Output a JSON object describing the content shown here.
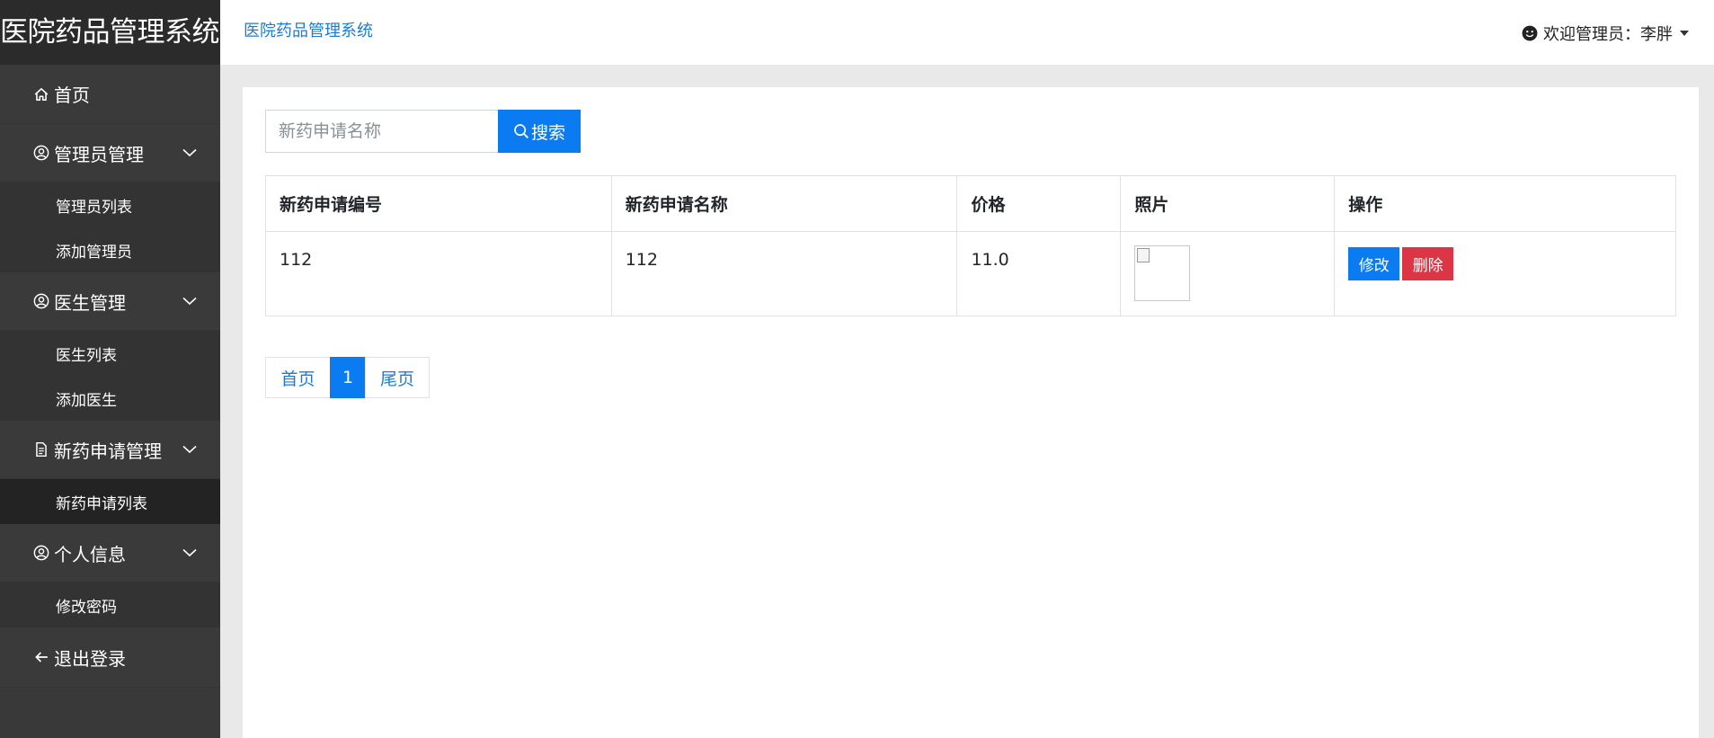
{
  "sidebar": {
    "brand": "医院药品管理系统",
    "home": "首页",
    "groups": [
      {
        "label": "管理员管理",
        "items": [
          "管理员列表",
          "添加管理员"
        ]
      },
      {
        "label": "医生管理",
        "items": [
          "医生列表",
          "添加医生"
        ]
      },
      {
        "label": "新药申请管理",
        "items": [
          "新药申请列表"
        ]
      },
      {
        "label": "个人信息",
        "items": [
          "修改密码"
        ]
      }
    ],
    "logout": "退出登录",
    "active_item": "新药申请列表"
  },
  "header": {
    "breadcrumb": "医院药品管理系统",
    "welcome": "欢迎管理员：李胖"
  },
  "search": {
    "placeholder": "新药申请名称",
    "button_label": "搜索"
  },
  "table": {
    "headers": [
      "新药申请编号",
      "新药申请名称",
      "价格",
      "照片",
      "操作"
    ],
    "rows": [
      {
        "id": "112",
        "name": "112",
        "price": "11.0",
        "edit_label": "修改",
        "delete_label": "删除"
      }
    ]
  },
  "pagination": {
    "first": "首页",
    "current": "1",
    "last": "尾页"
  },
  "colors": {
    "primary": "#0a7bf0",
    "danger": "#dc3545",
    "sidebar_bg": "#393939",
    "link": "#1f7bd0"
  }
}
